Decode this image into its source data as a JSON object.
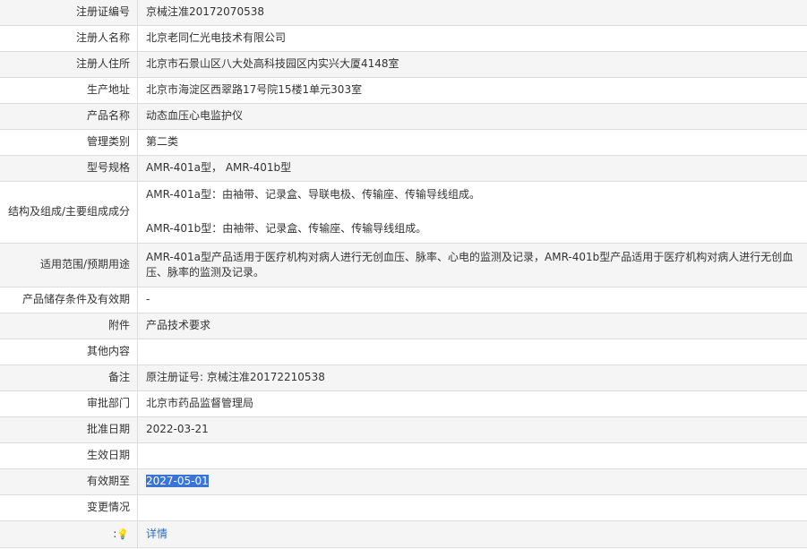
{
  "rows": [
    {
      "label": "注册证编号",
      "value": "京械注准20172070538"
    },
    {
      "label": "注册人名称",
      "value": "北京老同仁光电技术有限公司"
    },
    {
      "label": "注册人住所",
      "value": "北京市石景山区八大处高科技园区内实兴大厦4148室"
    },
    {
      "label": "生产地址",
      "value": "北京市海淀区西翠路17号院15楼1单元303室"
    },
    {
      "label": "产品名称",
      "value": "动态血压心电监护仪"
    },
    {
      "label": "管理类别",
      "value": "第二类"
    },
    {
      "label": "型号规格",
      "value": "AMR-401a型， AMR-401b型"
    },
    {
      "label": "结构及组成/主要组成成分",
      "value_lines": [
        "AMR-401a型：由袖带、记录盒、导联电极、传输座、传输导线组成。",
        "AMR-401b型：由袖带、记录盒、传输座、传输导线组成。"
      ]
    },
    {
      "label": "适用范围/预期用途",
      "value": "AMR-401a型产品适用于医疗机构对病人进行无创血压、脉率、心电的监测及记录，AMR-401b型产品适用于医疗机构对病人进行无创血压、脉率的监测及记录。"
    },
    {
      "label": "产品储存条件及有效期",
      "value": "-"
    },
    {
      "label": "附件",
      "value": "产品技术要求"
    },
    {
      "label": "其他内容",
      "value": ""
    },
    {
      "label": "备注",
      "value": "原注册证号: 京械注准20172210538"
    },
    {
      "label": "审批部门",
      "value": "北京市药品监督管理局"
    },
    {
      "label": "批准日期",
      "value": "2022-03-21"
    },
    {
      "label": "生效日期",
      "value": ""
    },
    {
      "label": "有效期至",
      "value": "2027-05-01"
    },
    {
      "label": "变更情况",
      "value": ""
    }
  ],
  "footer": {
    "icon": "lightbulb-icon",
    "link_text": "详情"
  }
}
